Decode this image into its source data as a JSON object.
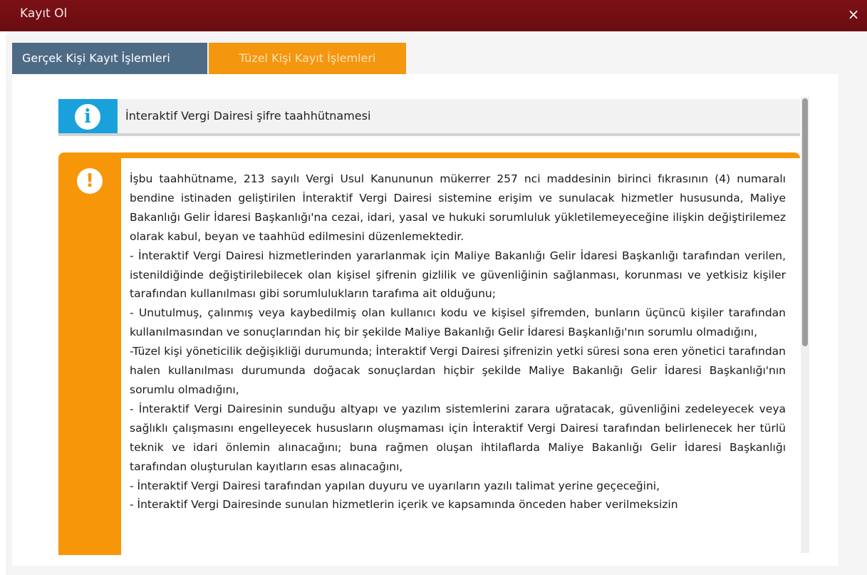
{
  "window": {
    "title": "Kayıt Ol",
    "close_label": "×"
  },
  "tabs": [
    {
      "label": "Gerçek Kişi Kayıt İşlemleri",
      "active": false
    },
    {
      "label": "Tüzel Kişi Kayıt İşlemleri",
      "active": true
    }
  ],
  "info": {
    "icon": "info-icon",
    "icon_glyph": "i",
    "text": "İnteraktif Vergi Dairesi şifre taahhütnamesi",
    "color": "#1aa1dc"
  },
  "warning": {
    "icon": "exclamation-icon",
    "icon_glyph": "!",
    "color": "#f79609",
    "paragraphs": [
      "İşbu taahhütname, 213 sayılı Vergi Usul Kanununun mükerrer 257 nci maddesinin birinci fıkrasının (4) numaralı bendine istinaden geliştirilen İnteraktif Vergi Dairesi sistemine erişim ve sunulacak hizmetler hususunda, Maliye Bakanlığı Gelir İdaresi Başkanlığı'na cezai, idari, yasal ve hukuki sorumluluk yükletilemeyeceğine ilişkin değiştirilemez olarak kabul, beyan ve taahhüd edilmesini düzenlemektedir.",
      "- İnteraktif Vergi Dairesi hizmetlerinden yararlanmak için Maliye Bakanlığı Gelir İdaresi Başkanlığı tarafından verilen, istenildiğinde değiştirilebilecek olan kişisel şifrenin gizlilik ve güvenliğinin sağlanması, korunması ve yetkisiz kişiler tarafından kullanılması gibi sorumlulukların tarafıma ait olduğunu;",
      "- Unutulmuş, çalınmış veya kaybedilmiş olan kullanıcı kodu ve kişisel şifremden, bunların üçüncü kişiler tarafından kullanılmasından ve sonuçlarından hiç bir şekilde Maliye Bakanlığı Gelir İdaresi Başkanlığı'nın sorumlu olmadığını,",
      "-Tüzel kişi yöneticilik değişikliği durumunda; İnteraktif Vergi Dairesi şifrenizin yetki süresi sona eren yönetici tarafından halen kullanılması durumunda doğacak sonuçlardan hiçbir şekilde Maliye Bakanlığı Gelir İdaresi Başkanlığı'nın sorumlu olmadığını,",
      "- İnteraktif Vergi Dairesinin sunduğu altyapı ve yazılım sistemlerini zarara uğratacak, güvenliğini zedeleyecek veya sağlıklı çalışmasını engelleyecek hususların oluşmaması için İnteraktif Vergi Dairesi tarafından belirlenecek her türlü teknik ve idari önlemin alınacağını; buna rağmen oluşan ihtilaflarda Maliye Bakanlığı Gelir İdaresi Başkanlığı tarafından oluşturulan kayıtların esas alınacağını,",
      "- İnteraktif Vergi Dairesi tarafından yapılan duyuru ve uyarıların yazılı talimat yerine geçeceğini,",
      "- İnteraktif Vergi Dairesinde sunulan hizmetlerin içerik ve kapsamında önceden haber verilmeksizin"
    ]
  },
  "theme": {
    "titlebar": "#7b1116",
    "tab_inactive": "#4e6b86",
    "tab_active": "#f5960f"
  }
}
